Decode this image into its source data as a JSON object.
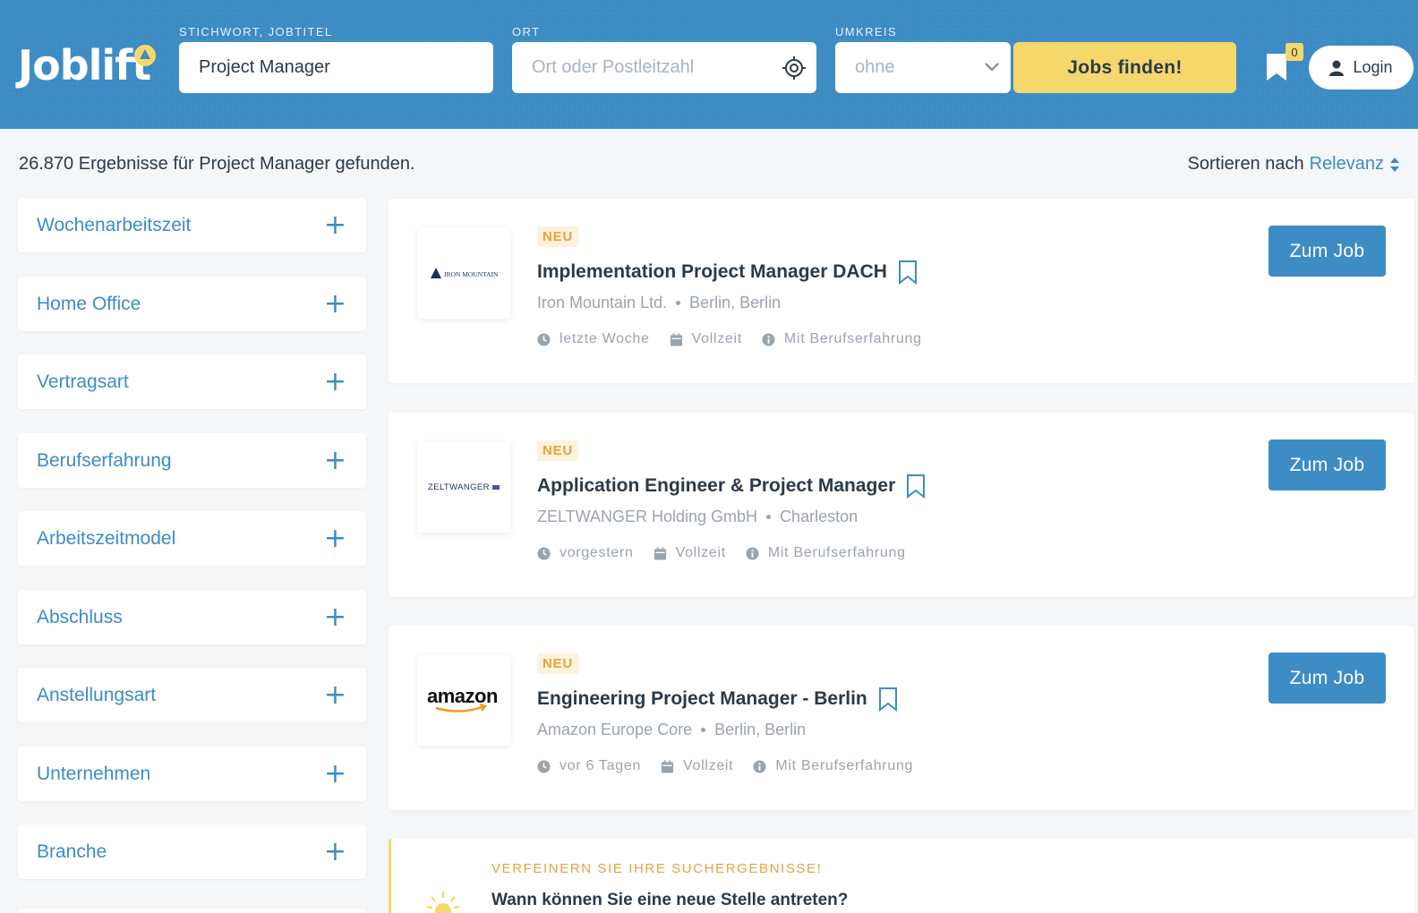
{
  "header": {
    "logo_text": "Joblift",
    "keyword": {
      "label": "STICHWORT, JOBTITEL",
      "value": "Project Manager"
    },
    "location": {
      "label": "ORT",
      "placeholder": "Ort oder Postleitzahl"
    },
    "radius": {
      "label": "UMKREIS",
      "value": "ohne"
    },
    "search_button": "Jobs finden!",
    "saved_count": "0",
    "login_label": "Login",
    "colors": {
      "header_bg": "#3d8cc4",
      "accent_yellow": "#f5d86b"
    }
  },
  "results": {
    "summary": "26.870 Ergebnisse für Project Manager gefunden.",
    "sort_label": "Sortieren nach",
    "sort_value": "Relevanz"
  },
  "filters": [
    {
      "label": "Wochenarbeitszeit"
    },
    {
      "label": "Home Office"
    },
    {
      "label": "Vertragsart"
    },
    {
      "label": "Berufserfahrung"
    },
    {
      "label": "Arbeitszeitmodel"
    },
    {
      "label": "Abschluss"
    },
    {
      "label": "Anstellungsart"
    },
    {
      "label": "Unternehmen"
    },
    {
      "label": "Branche"
    }
  ],
  "jobs": [
    {
      "badge": "NEU",
      "title": "Implementation Project Manager DACH",
      "company": "Iron Mountain Ltd.",
      "location": "Berlin, Berlin",
      "posted": "letzte Woche",
      "type": "Vollzeit",
      "experience": "Mit Berufserfahrung",
      "button": "Zum Job",
      "logo_text": "IRON MOUNTAIN"
    },
    {
      "badge": "NEU",
      "title": "Application Engineer & Project Manager",
      "company": "ZELTWANGER Holding GmbH",
      "location": "Charleston",
      "posted": "vorgestern",
      "type": "Vollzeit",
      "experience": "Mit Berufserfahrung",
      "button": "Zum Job",
      "logo_text": "ZELTWANGER"
    },
    {
      "badge": "NEU",
      "title": "Engineering Project Manager - Berlin",
      "company": "Amazon Europe Core",
      "location": "Berlin, Berlin",
      "posted": "vor 6 Tagen",
      "type": "Vollzeit",
      "experience": "Mit Berufserfahrung",
      "button": "Zum Job",
      "logo_text": "amazon"
    }
  ],
  "refine": {
    "label": "VERFEINERN SIE IHRE SUCHERGEBNISSE!",
    "question": "Wann können Sie eine neue Stelle antreten?"
  }
}
